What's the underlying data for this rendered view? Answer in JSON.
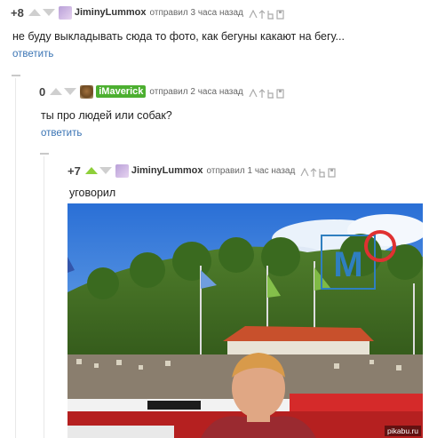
{
  "comments": [
    {
      "rating": "+8",
      "author": "JiminyLummox",
      "meta": "отправил 3 часа назад",
      "text": "не буду выкладывать сюда то фото, как бегуны какают на бегу...",
      "reply_label": "ответить"
    },
    {
      "rating": "0",
      "author": "iMaverick",
      "meta": "отправил 2 часа назад",
      "text": "ты про людей или собак?",
      "reply_label": "ответить"
    },
    {
      "rating": "+7",
      "author": "JiminyLummox",
      "meta": "отправил 1 час назад",
      "text": "уговорил"
    }
  ],
  "image": {
    "description": "photo of runner at stadium",
    "logo_text": "M",
    "watermark": "pikabu.ru"
  },
  "colors": {
    "link": "#3a74b4",
    "upvote_active": "#8ecf3a",
    "badge": "#4caf30"
  }
}
